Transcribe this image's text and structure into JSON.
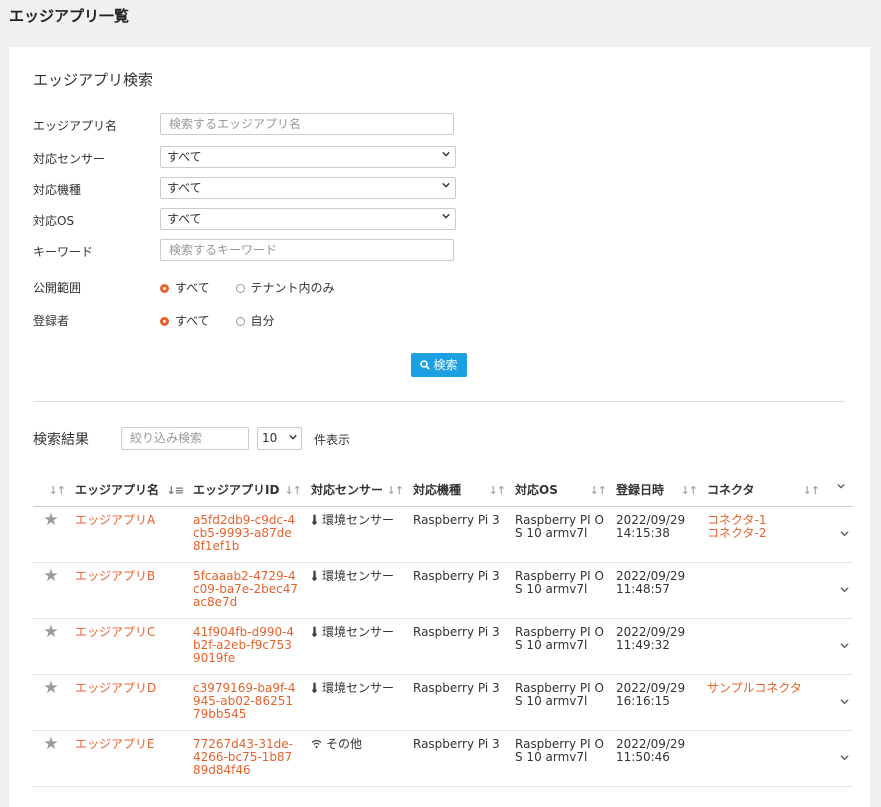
{
  "page_title": "エッジアプリ一覧",
  "search": {
    "title": "エッジアプリ検索",
    "fields": {
      "app_name": {
        "label": "エッジアプリ名",
        "placeholder": "検索するエッジアプリ名"
      },
      "sensor": {
        "label": "対応センサー",
        "value": "すべて"
      },
      "device": {
        "label": "対応機種",
        "value": "すべて"
      },
      "os": {
        "label": "対応OS",
        "value": "すべて"
      },
      "keyword": {
        "label": "キーワード",
        "placeholder": "検索するキーワード"
      },
      "scope": {
        "label": "公開範囲",
        "options": [
          "すべて",
          "テナント内のみ"
        ],
        "selected": "すべて"
      },
      "registrant": {
        "label": "登録者",
        "options": [
          "すべて",
          "自分"
        ],
        "selected": "すべて"
      }
    },
    "button_label": "検索"
  },
  "results": {
    "title": "検索結果",
    "filter_placeholder": "絞り込み検索",
    "per_page": "10",
    "per_page_label": "件表示",
    "columns": [
      "エッジアプリ名",
      "エッジアプリID",
      "対応センサー",
      "対応機種",
      "対応OS",
      "登録日時",
      "コネクタ"
    ],
    "rows": [
      {
        "name": "エッジアプリA",
        "id": "a5fd2db9-c9dc-4cb5-9993-a87de8f1ef1b",
        "sensor": "環境センサー",
        "sensor_icon": "thermometer-icon",
        "device": "Raspberry Pi 3",
        "os": "Raspberry PI OS 10 armv7l",
        "date": "2022/09/29",
        "time": "14:15:38",
        "connectors": [
          "コネクタ-1",
          "コネクタ-2"
        ]
      },
      {
        "name": "エッジアプリB",
        "id": "5fcaaab2-4729-4c09-ba7e-2bec47ac8e7d",
        "sensor": "環境センサー",
        "sensor_icon": "thermometer-icon",
        "device": "Raspberry Pi 3",
        "os": "Raspberry PI OS 10 armv7l",
        "date": "2022/09/29",
        "time": "11:48:57",
        "connectors": []
      },
      {
        "name": "エッジアプリC",
        "id": "41f904fb-d990-4b2f-a2eb-f9c7539019fe",
        "sensor": "環境センサー",
        "sensor_icon": "thermometer-icon",
        "device": "Raspberry Pi 3",
        "os": "Raspberry PI OS 10 armv7l",
        "date": "2022/09/29",
        "time": "11:49:32",
        "connectors": []
      },
      {
        "name": "エッジアプリD",
        "id": "c3979169-ba9f-4945-ab02-8625179bb545",
        "sensor": "環境センサー",
        "sensor_icon": "thermometer-icon",
        "device": "Raspberry Pi 3",
        "os": "Raspberry PI OS 10 armv7l",
        "date": "2022/09/29",
        "time": "16:16:15",
        "connectors": [
          "サンプルコネクタ"
        ]
      },
      {
        "name": "エッジアプリE",
        "id": "77267d43-31de-4266-bc75-1b8789d84f46",
        "sensor": "その他",
        "sensor_icon": "wifi-icon",
        "device": "Raspberry Pi 3",
        "os": "Raspberry PI OS 10 armv7l",
        "date": "2022/09/29",
        "time": "11:50:46",
        "connectors": []
      }
    ]
  },
  "colors": {
    "accent": "#e8612b",
    "primary_button": "#1ba0e1"
  }
}
